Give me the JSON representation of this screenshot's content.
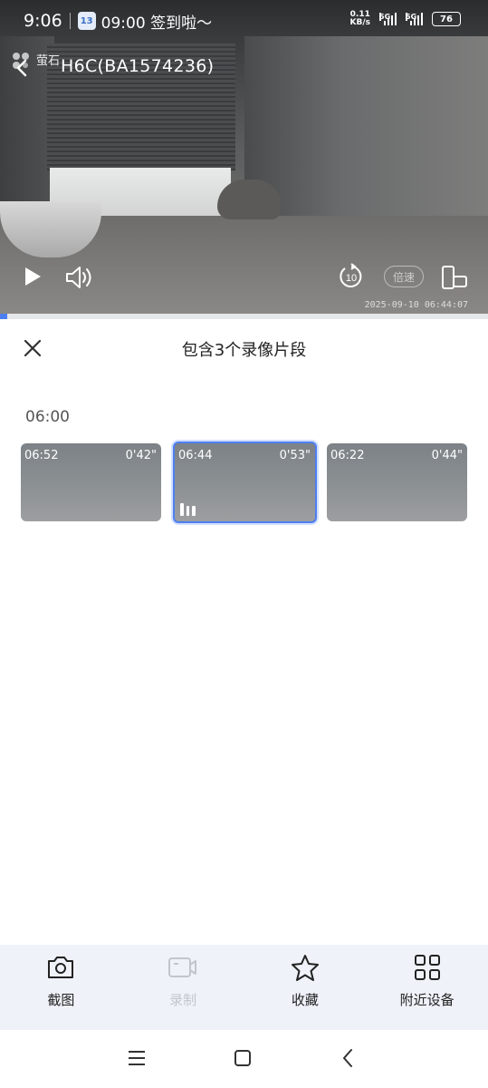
{
  "status_bar": {
    "time": "9:06",
    "badge": "13",
    "notification": "09:00 签到啦～",
    "net_speed_value": "0.11",
    "net_speed_unit": "KB/s",
    "sim1": "5G",
    "sim2": "5G",
    "battery": "76"
  },
  "video": {
    "logo_text": "萤石",
    "device_title": "H6C(BA1574236)",
    "speed_label": "倍速",
    "replay_seconds": "10",
    "osd_timestamp": "2025-09-10 06:44:07",
    "playback_progress": 0.015
  },
  "panel": {
    "title": "包含3个录像片段",
    "time_group": "06:00",
    "clips": [
      {
        "start": "06:52",
        "duration": "0'42\"",
        "active": false
      },
      {
        "start": "06:44",
        "duration": "0'53\"",
        "active": true
      },
      {
        "start": "06:22",
        "duration": "0'44\"",
        "active": false
      }
    ]
  },
  "toolbar": {
    "items": [
      {
        "label": "截图",
        "icon": "camera-icon",
        "enabled": true
      },
      {
        "label": "录制",
        "icon": "video-record-icon",
        "enabled": false
      },
      {
        "label": "收藏",
        "icon": "star-icon",
        "enabled": true
      },
      {
        "label": "附近设备",
        "icon": "grid-icon",
        "enabled": true
      }
    ]
  },
  "colors": {
    "accent": "#4d7ff2",
    "toolbar_bg": "#eff2f9",
    "disabled_text": "#c2c5cc"
  }
}
